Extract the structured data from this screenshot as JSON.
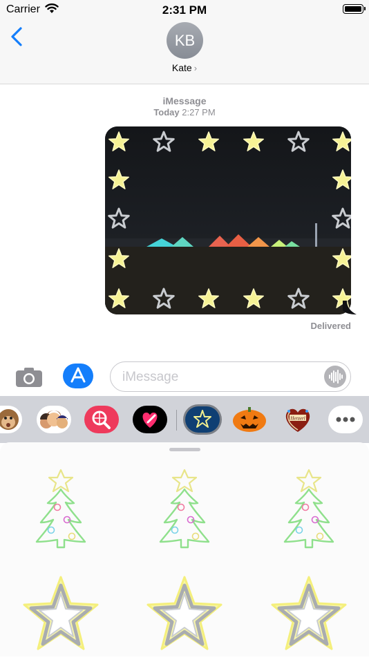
{
  "status_bar": {
    "carrier": "Carrier",
    "time": "2:31 PM"
  },
  "header": {
    "avatar_initials": "KB",
    "contact_name": "Kate",
    "contact_chevron": "›"
  },
  "conversation": {
    "service": "iMessage",
    "timestamp_day": "Today",
    "timestamp_time": "2:27 PM",
    "message_status": "Delivered"
  },
  "composer": {
    "placeholder": "iMessage"
  },
  "colors": {
    "accent": "#147efb",
    "bubble_tail": "#101114",
    "neon_yellow": "#f7f28a",
    "neon_green": "#8fe08c"
  },
  "app_drawer": {
    "icons": [
      "monkey-animoji-icon",
      "memoji-icon",
      "web-search-icon",
      "digital-touch-icon",
      "neon-star-app-icon",
      "pumpkin-app-icon",
      "gingerbread-heart-app-icon",
      "more-apps-icon"
    ],
    "gingerbread_text": "Herzerl"
  },
  "stickers": [
    "christmas-tree-sticker",
    "christmas-tree-sticker",
    "christmas-tree-sticker",
    "star-sticker",
    "star-sticker",
    "star-sticker"
  ]
}
